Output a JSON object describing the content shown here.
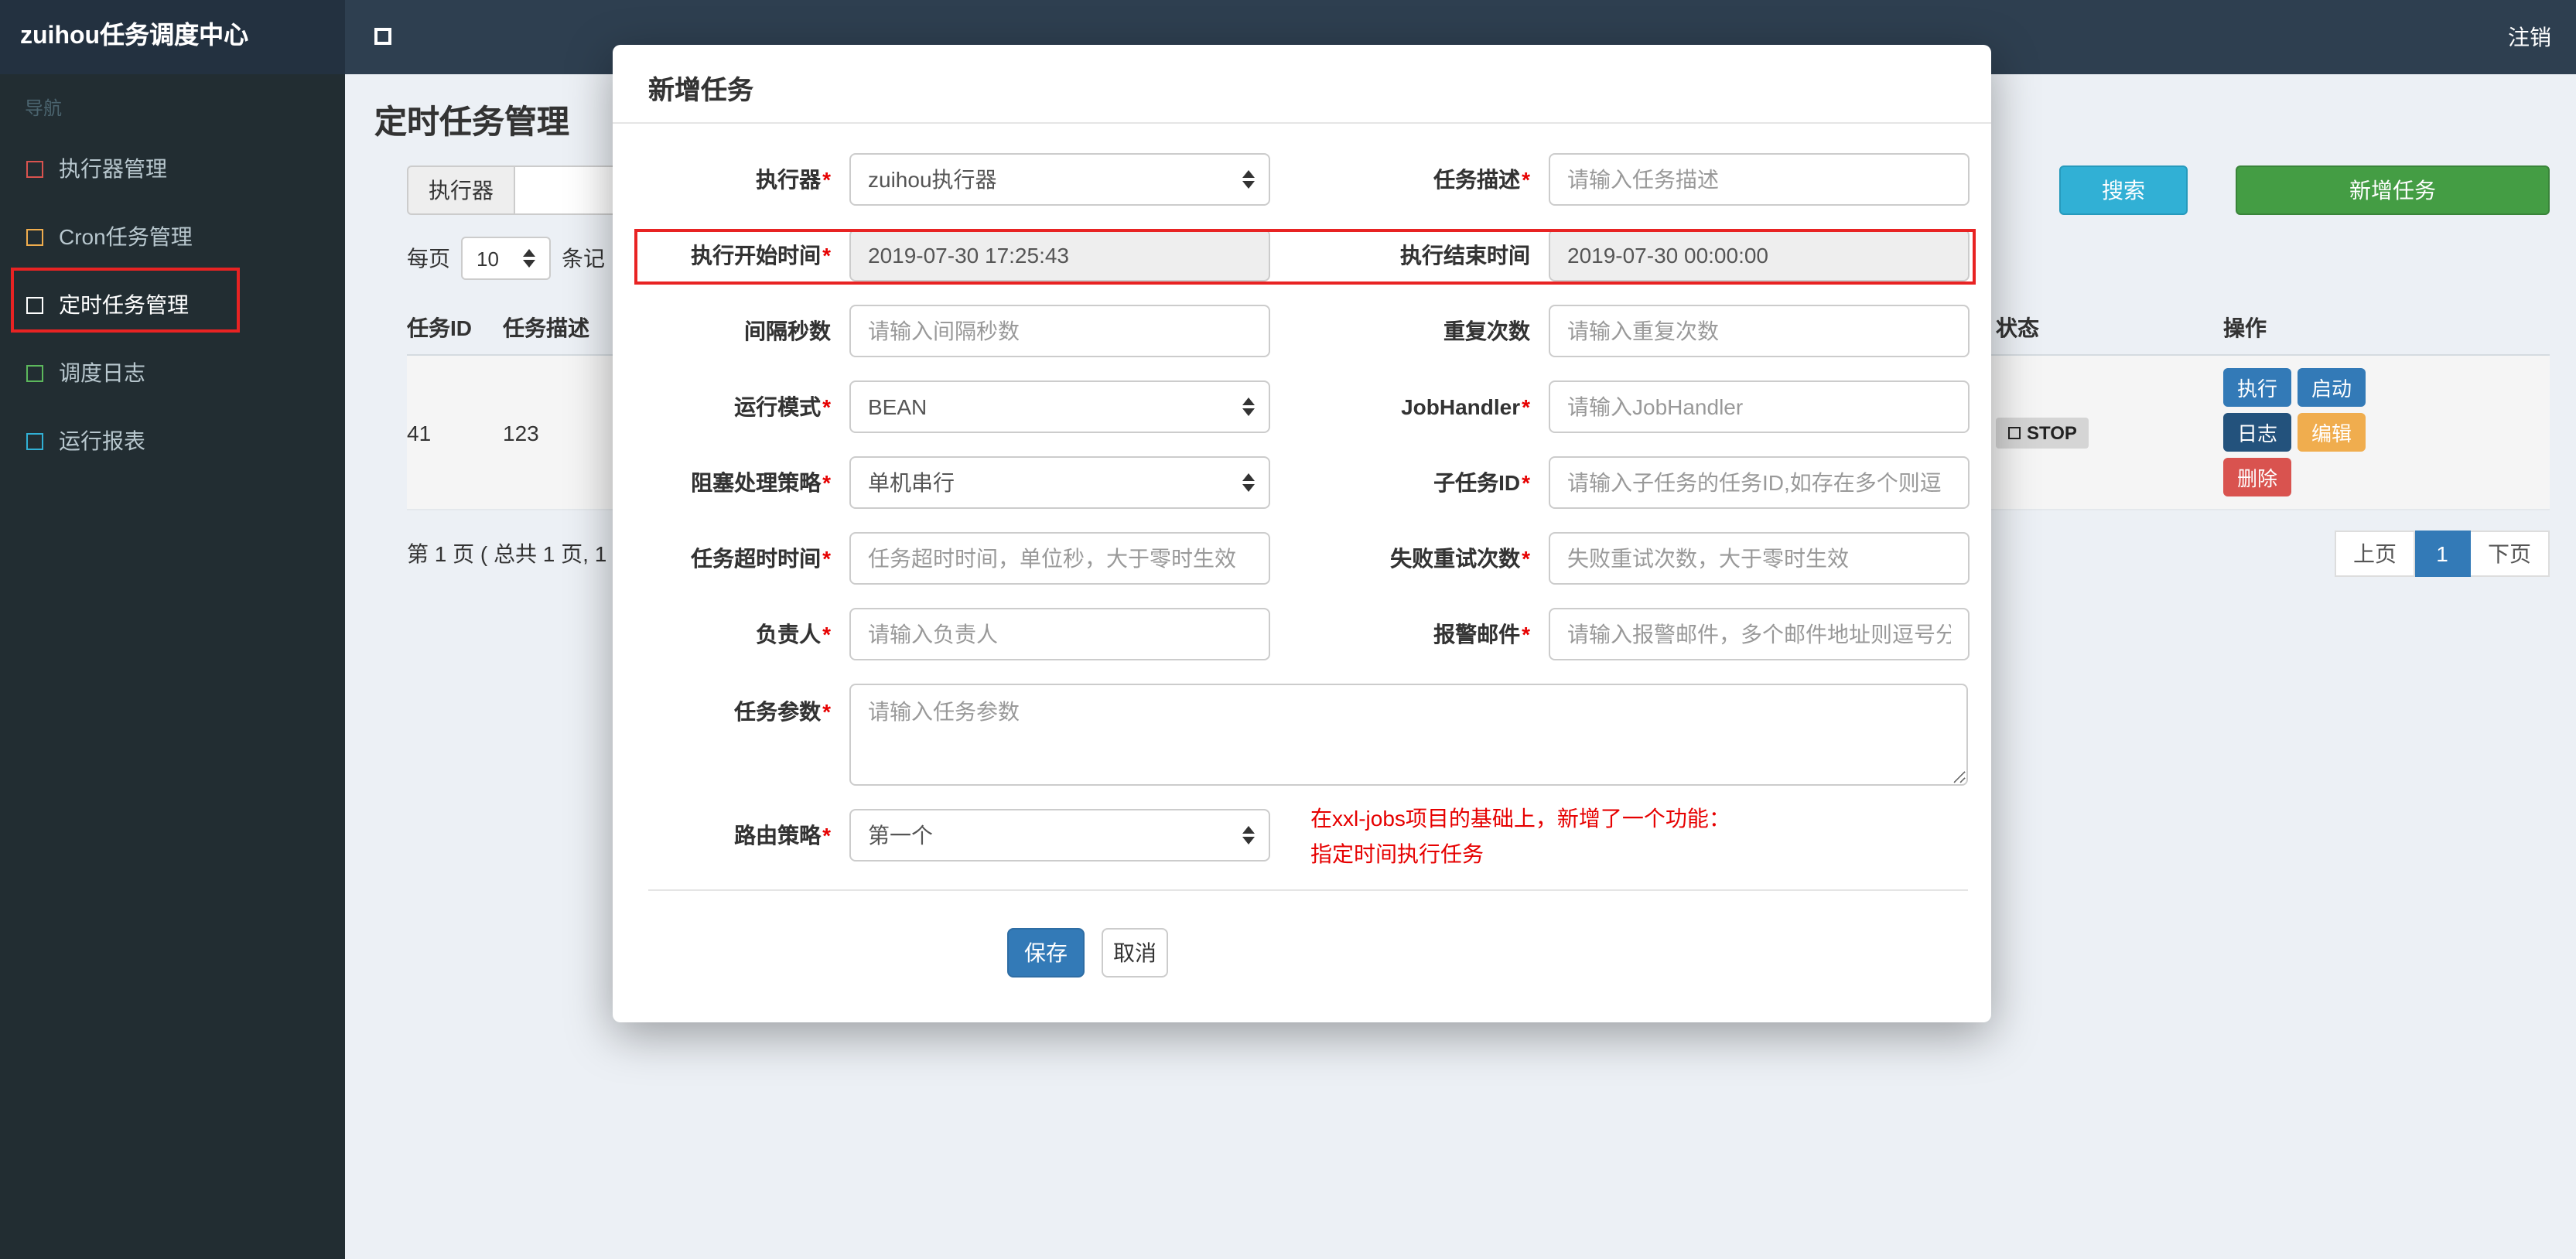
{
  "navbar": {
    "brand": "zuihou任务调度中心",
    "logout": "注销"
  },
  "sidebar": {
    "nav_label": "导航",
    "items": [
      {
        "label": "执行器管理",
        "icon_color": "#d9534f"
      },
      {
        "label": "Cron任务管理",
        "icon_color": "#f0ad4e"
      },
      {
        "label": "定时任务管理",
        "icon_color": "#ffffff",
        "active": true
      },
      {
        "label": "调度日志",
        "icon_color": "#5cb85c"
      },
      {
        "label": "运行报表",
        "icon_color": "#31b0d5"
      }
    ]
  },
  "page": {
    "title": "定时任务管理",
    "filter": {
      "executor_label": "执行器",
      "search_button": "搜索",
      "add_button": "新增任务"
    },
    "per_page": {
      "prefix": "每页",
      "value": "10",
      "suffix": "条记"
    },
    "table": {
      "headers": [
        "任务ID",
        "任务描述",
        "状态",
        "操作"
      ],
      "row": {
        "id": "41",
        "desc": "123",
        "status": "STOP",
        "actions": [
          {
            "label": "执行",
            "color": "#337ab7"
          },
          {
            "label": "启动",
            "color": "#337ab7"
          },
          {
            "label": "日志",
            "color": "#23527c"
          },
          {
            "label": "编辑",
            "color": "#f0ad4e"
          },
          {
            "label": "删除",
            "color": "#d9534f"
          }
        ]
      }
    },
    "pagination": {
      "summary": "第 1 页 ( 总共 1 页, 1",
      "prev": "上页",
      "current": "1",
      "next": "下页"
    }
  },
  "modal": {
    "title": "新增任务",
    "required_marker": "*",
    "fields": {
      "executor": {
        "label": "执行器",
        "value": "zuihou执行器"
      },
      "job_desc": {
        "label": "任务描述",
        "placeholder": "请输入任务描述"
      },
      "start_time": {
        "label": "执行开始时间",
        "value": "2019-07-30 17:25:43"
      },
      "end_time": {
        "label": "执行结束时间",
        "value": "2019-07-30 00:00:00"
      },
      "interval_seconds": {
        "label": "间隔秒数",
        "placeholder": "请输入间隔秒数"
      },
      "repeat_count": {
        "label": "重复次数",
        "placeholder": "请输入重复次数"
      },
      "run_mode": {
        "label": "运行模式",
        "value": "BEAN"
      },
      "job_handler": {
        "label": "JobHandler",
        "placeholder": "请输入JobHandler"
      },
      "block_strategy": {
        "label": "阻塞处理策略",
        "value": "单机串行"
      },
      "child_job_id": {
        "label": "子任务ID",
        "placeholder": "请输入子任务的任务ID,如存在多个则逗"
      },
      "timeout": {
        "label": "任务超时时间",
        "placeholder": "任务超时时间，单位秒，大于零时生效"
      },
      "fail_retry": {
        "label": "失败重试次数",
        "placeholder": "失败重试次数，大于零时生效"
      },
      "owner": {
        "label": "负责人",
        "placeholder": "请输入负责人"
      },
      "alarm_email": {
        "label": "报警邮件",
        "placeholder": "请输入报警邮件，多个邮件地址则逗号分"
      },
      "job_param": {
        "label": "任务参数",
        "placeholder": "请输入任务参数"
      },
      "route_strategy": {
        "label": "路由策略",
        "value": "第一个"
      }
    },
    "note_line1": "在xxl-jobs项目的基础上，新增了一个功能：",
    "note_line2": "指定时间执行任务",
    "save_button": "保存",
    "cancel_button": "取消"
  }
}
